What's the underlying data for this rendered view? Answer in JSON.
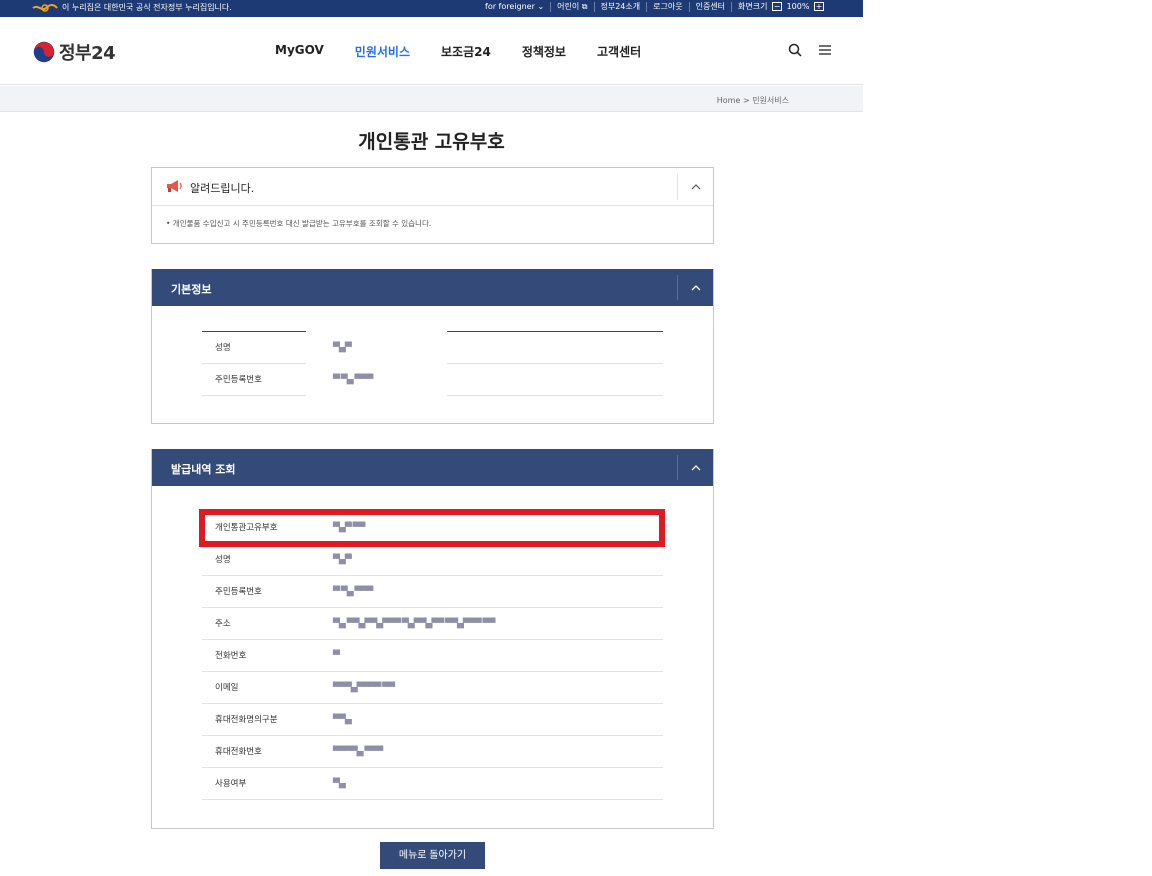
{
  "topbar": {
    "egov_text": "이 누리집은 대한민국 공식 전자정부 누리집입니다.",
    "links": [
      "for foreigner",
      "어린이",
      "정부24소개",
      "로그아웃",
      "인증센터",
      "화면크기"
    ],
    "zoom_level": "100%",
    "zoom_minus": "−",
    "zoom_plus": "+"
  },
  "header": {
    "logo_text": "정부24",
    "nav": [
      "MyGOV",
      "민원서비스",
      "보조금24",
      "정책정보",
      "고객센터"
    ],
    "active_nav": "민원서비스"
  },
  "breadcrumb": {
    "home": "Home",
    "sep": ">",
    "current": "민원서비스"
  },
  "page_title": "개인통관 고유부호",
  "notice": {
    "title": "알려드립니다.",
    "body": "• 개인물품 수입신고 시 주민등록번호 대신 발급받는 고유부호를 조회할 수 있습니다."
  },
  "basic_info": {
    "title": "기본정보",
    "rows": [
      {
        "label": "성명",
        "value": "▀▄▀"
      },
      {
        "label": "주민등록번호",
        "value": "▀ ▀▄ ▀▀▀"
      }
    ]
  },
  "issue_history": {
    "title": "발급내역 조회",
    "rows": [
      {
        "label": "개인통관고유부호",
        "value": "▀▄▀ ▀▀"
      },
      {
        "label": "성명",
        "value": "▀▄▀"
      },
      {
        "label": "주민등록번호",
        "value": "▀ ▀▄ ▀▀▀"
      },
      {
        "label": "주소",
        "value": "▀▄ ▀▀▄▀▀▄▀▀▀ ▀▄▀▀▄▀▀ ▀▀▄▀▀▀ ▀▀"
      },
      {
        "label": "전화번호",
        "value": "▀"
      },
      {
        "label": "이메일",
        "value": "▀▀▀▄▀▀▀▀ ▀▀"
      },
      {
        "label": "휴대전화명의구분",
        "value": "▀▀▄"
      },
      {
        "label": "휴대전화번호",
        "value": "▀▀▀▀▄ ▀▀▀"
      },
      {
        "label": "사용여부",
        "value": "▀▄"
      }
    ]
  },
  "back_button": "메뉴로 돌아가기",
  "colors": {
    "navy": "#1d3a74",
    "panel_header": "#344b7a",
    "active_nav": "#256ef4",
    "highlight": "#e01a22"
  }
}
